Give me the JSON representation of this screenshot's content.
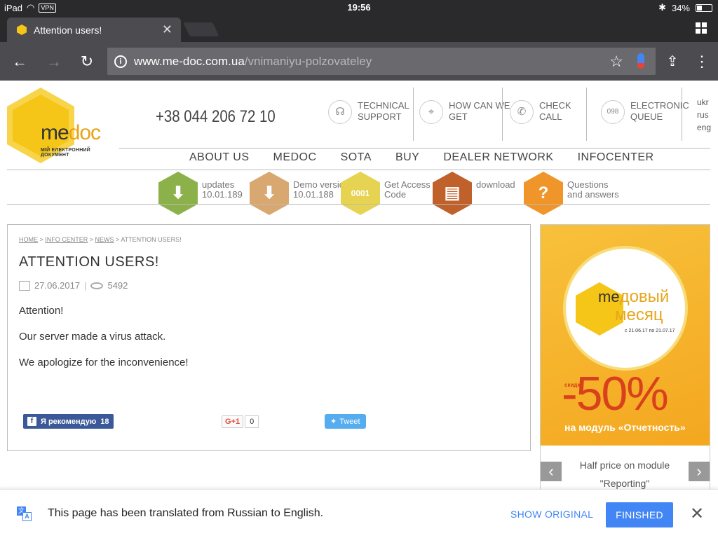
{
  "status_bar": {
    "device": "iPad",
    "vpn": "VPN",
    "time": "19:56",
    "battery": "34%",
    "battery_level": 0.34
  },
  "tab": {
    "title": "Attention users!"
  },
  "omnibox": {
    "domain": "www.me-doc.com.ua",
    "path": "/vnimaniyu-polzovateley"
  },
  "site": {
    "logo": {
      "text_me": "me",
      "text_doc": "doc",
      "tagline": "МІЙ ЕЛЕКТРОННИЙ ДОКУМЕНТ"
    },
    "phone": "+38 044 206 72 10",
    "contacts": [
      {
        "line1": "TECHNICAL",
        "line2": "SUPPORT"
      },
      {
        "line1": "HOW CAN WE",
        "line2": "GET"
      },
      {
        "line1": "CHECK",
        "line2": "CALL"
      },
      {
        "line1": "ELECTRONIC",
        "line2": "QUEUE"
      }
    ],
    "languages": [
      "ukr",
      "rus",
      "eng"
    ],
    "nav": [
      "ABOUT US",
      "MEDOC",
      "SOTA",
      "BUY",
      "DEALER NETWORK",
      "INFOCENTER"
    ],
    "quick_links": [
      {
        "line1": "updates",
        "line2": "10.01.189",
        "color": "#8db14a"
      },
      {
        "line1": "Demo version",
        "line2": "10.01.188",
        "color": "#d9a870"
      },
      {
        "line1": "Get Access",
        "line2": "Code",
        "color": "#e6d352"
      },
      {
        "line1": "download",
        "line2": "",
        "color": "#c0612b"
      },
      {
        "line1": "Questions",
        "line2": "and answers",
        "color": "#f0952a"
      }
    ]
  },
  "article": {
    "breadcrumb": [
      "HOME",
      "INFO CENTER",
      "NEWS",
      "ATTENTION USERS!"
    ],
    "title": "ATTENTION USERS!",
    "date": "27.06.2017",
    "views": "5492",
    "paragraphs": [
      "Attention!",
      "Our server made a virus attack.",
      "We apologize for the inconvenience!"
    ]
  },
  "share": {
    "fb_label": "Я рекомендую",
    "fb_count": "18",
    "gplus_label": "G+1",
    "gplus_count": "0",
    "tweet_label": "Tweet"
  },
  "banner": {
    "me": "me",
    "title_line1": "довый",
    "title_line2": "месяц",
    "dates": "с 21.06.17 по 21.07.17",
    "skidka": "скидка",
    "percent": "-50%",
    "module": "на модуль «Отчетность»",
    "caption": "Half price on module \"Reporting\""
  },
  "translate_bar": {
    "message": "This page has been translated from Russian to English.",
    "show_original": "SHOW ORIGINAL",
    "finished": "FINISHED"
  }
}
